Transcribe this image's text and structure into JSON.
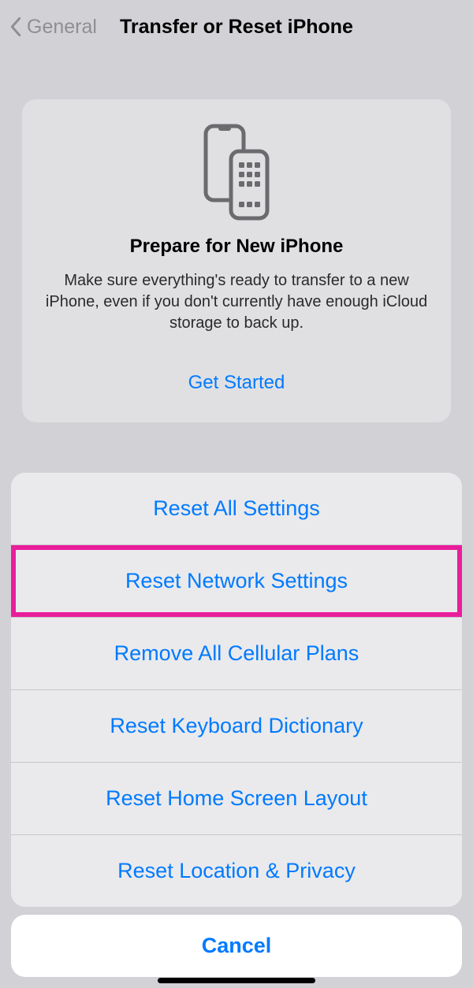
{
  "nav": {
    "back_label": "General",
    "title": "Transfer or Reset iPhone"
  },
  "card": {
    "title": "Prepare for New iPhone",
    "description": "Make sure everything's ready to transfer to a new iPhone, even if you don't currently have enough iCloud storage to back up.",
    "cta": "Get Started"
  },
  "sheet": {
    "options": [
      "Reset All Settings",
      "Reset Network Settings",
      "Remove All Cellular Plans",
      "Reset Keyboard Dictionary",
      "Reset Home Screen Layout",
      "Reset Location & Privacy"
    ],
    "highlighted_index": 1,
    "cancel": "Cancel"
  }
}
